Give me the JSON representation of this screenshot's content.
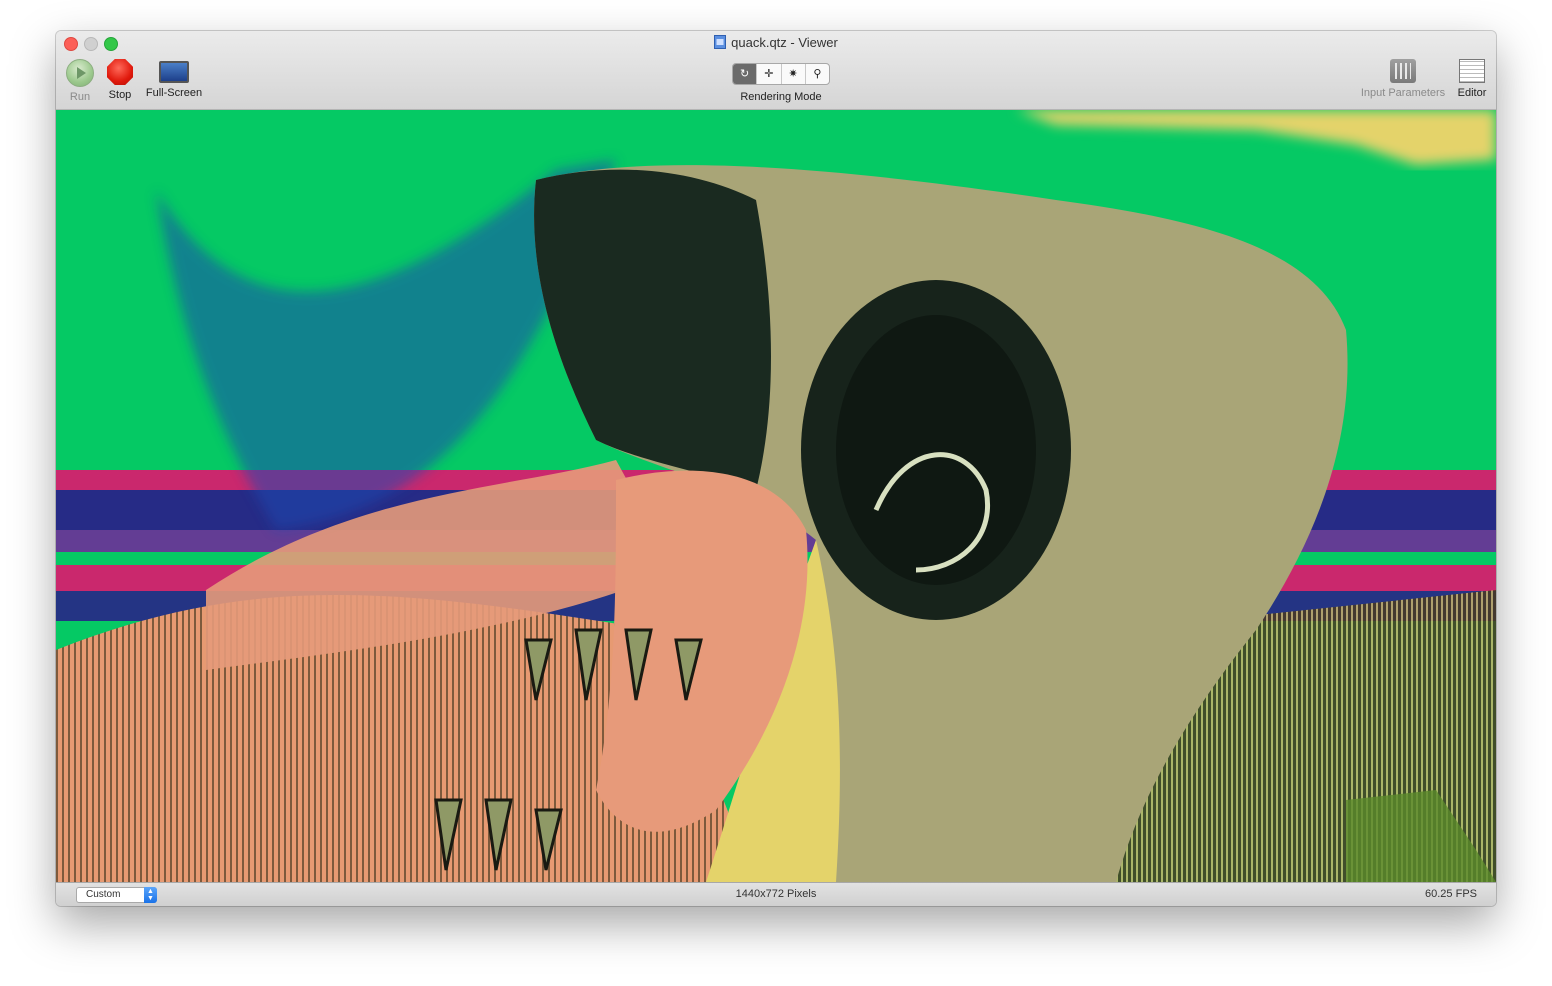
{
  "window": {
    "title": "quack.qtz - Viewer"
  },
  "toolbar": {
    "run_label": "Run",
    "stop_label": "Stop",
    "fullscreen_label": "Full-Screen",
    "rendering_mode_label": "Rendering Mode",
    "rendering_mode_options": [
      "↻",
      "✛",
      "✷",
      "⚲"
    ],
    "input_parameters_label": "Input Parameters",
    "editor_label": "Editor"
  },
  "statusbar": {
    "size_preset": "Custom",
    "dimensions": "1440x772 Pixels",
    "fps": "60.25 FPS"
  },
  "colors": {
    "background_green": "#05c964",
    "stop_red": "#e0190c",
    "yellow_band": "#e4d36a"
  }
}
